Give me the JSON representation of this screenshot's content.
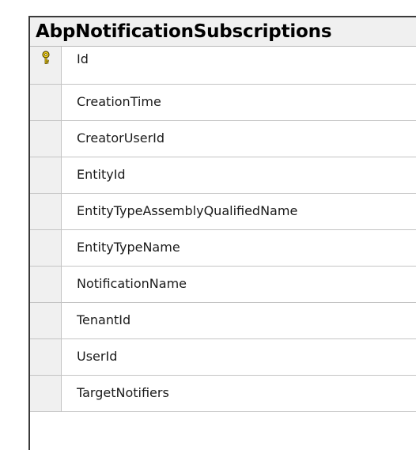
{
  "table": {
    "title": "AbpNotificationSubscriptions",
    "columns": [
      {
        "name": "Id",
        "primary_key": true,
        "icon": "primary-key-icon"
      },
      {
        "name": "CreationTime",
        "primary_key": false
      },
      {
        "name": "CreatorUserId",
        "primary_key": false
      },
      {
        "name": "EntityId",
        "primary_key": false
      },
      {
        "name": "EntityTypeAssemblyQualifiedName",
        "primary_key": false
      },
      {
        "name": "EntityTypeName",
        "primary_key": false
      },
      {
        "name": "NotificationName",
        "primary_key": false
      },
      {
        "name": "TenantId",
        "primary_key": false
      },
      {
        "name": "UserId",
        "primary_key": false
      },
      {
        "name": "TargetNotifiers",
        "primary_key": false
      }
    ]
  },
  "colors": {
    "border": "#3a3a3a",
    "header_bg": "#f0f0f0",
    "row_divider": "#c4c4c4",
    "key_fill": "#f2d21b",
    "key_stroke": "#5a4a00"
  }
}
